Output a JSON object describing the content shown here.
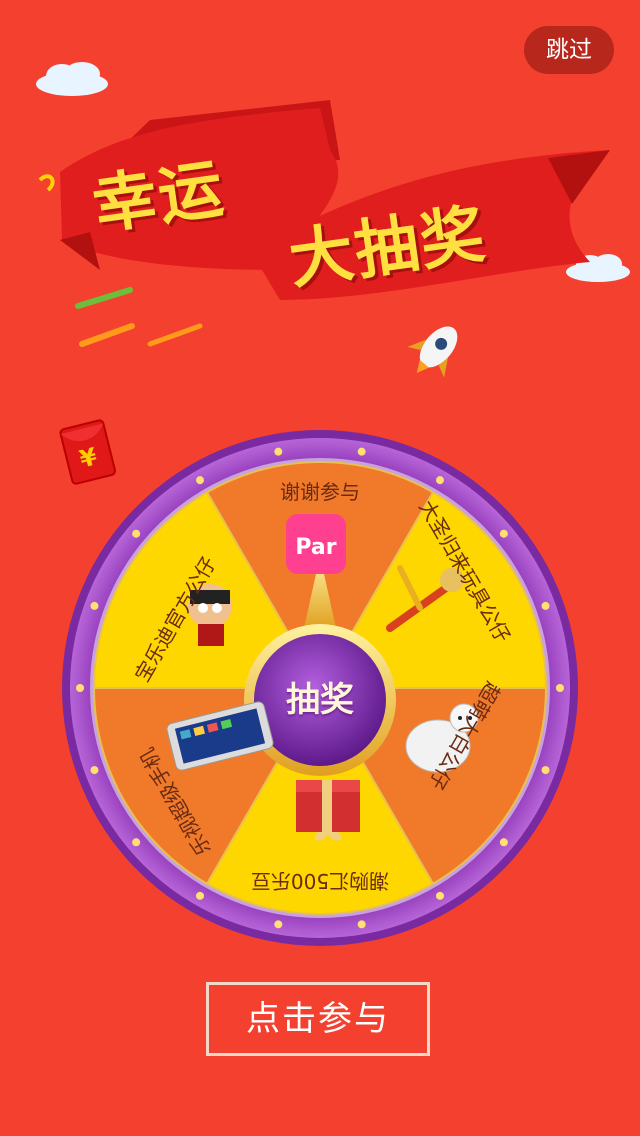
{
  "skip_label": "跳过",
  "title_line1": "幸运",
  "title_line2": "大抽奖",
  "redpacket_symbol": "¥",
  "wheel": {
    "spin_label": "抽奖",
    "segments": [
      {
        "label": "谢谢参与",
        "prize_icon": "par-app-icon"
      },
      {
        "label": "大圣归来玩具公仔",
        "prize_icon": "monkey-king-toy-icon"
      },
      {
        "label": "超萌大白公仔",
        "prize_icon": "baymax-toy-icon"
      },
      {
        "label": "潮购汇500乐豆",
        "prize_icon": "gift-box-icon"
      },
      {
        "label": "乐视超级手机",
        "prize_icon": "smartphone-icon"
      },
      {
        "label": "宝乐迪官方公仔",
        "prize_icon": "mascot-doll-icon"
      }
    ],
    "app_icon_text": "Par"
  },
  "join_button_label": "点击参与",
  "colors": {
    "background": "#f4402e",
    "wheel_rim": "#9b3fbf",
    "segment_yellow": "#ffd700",
    "segment_orange": "#f07a2a",
    "spin_button": "#7a2aa8"
  }
}
